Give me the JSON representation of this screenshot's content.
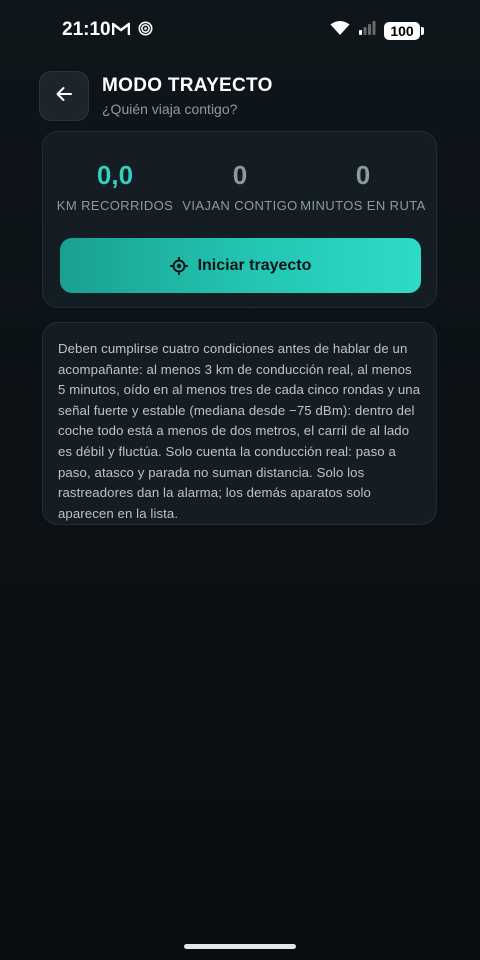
{
  "status_bar": {
    "time": "21:10",
    "left_icons": [
      "gmail-icon",
      "target-notification-icon"
    ],
    "right_icons": [
      "wifi-icon",
      "cell-signal-icon"
    ],
    "battery": "100"
  },
  "header": {
    "back_icon": "arrow-left-icon",
    "title": "MODO TRAYECTO",
    "subtitle": "¿Quién viaja contigo?"
  },
  "stats": [
    {
      "value": "0,0",
      "label": "KM RECORRIDOS"
    },
    {
      "value": "0",
      "label": "VIAJAN CONTIGO"
    },
    {
      "value": "0",
      "label": "MINUTOS EN RUTA"
    }
  ],
  "start_button": {
    "icon": "crosshair-icon",
    "label": "Iniciar trayecto"
  },
  "info": {
    "text": "Deben cumplirse cuatro condiciones antes de hablar de un acompañante: al menos 3 km de conducción real, al menos 5 minutos, oído en al menos tres de cada cinco rondas y una señal fuerte y estable (mediana desde −75 dBm): dentro del coche todo está a menos de dos metros, el carril de al lado es débil y fluctúa. Solo cuenta la conducción real: paso a paso, atasco y parada no suman distancia. Solo los rastreadores dan la alarma; los demás aparatos solo aparecen en la lista."
  },
  "colors": {
    "accent": "#33d0be",
    "background": "#0b1115",
    "card": "#141d23"
  }
}
